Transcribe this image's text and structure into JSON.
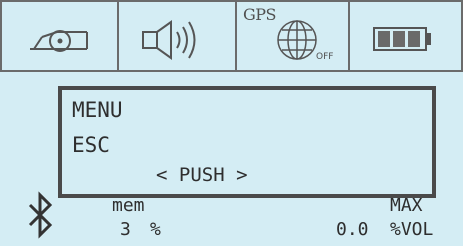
{
  "status_bar": {
    "icons": [
      "whistle-icon",
      "speaker-icon",
      "gps-globe-icon",
      "battery-icon"
    ],
    "gps_label": "GPS",
    "gps_state": "OFF"
  },
  "menu": {
    "items": [
      "MENU",
      "ESC"
    ],
    "action": "< PUSH >"
  },
  "footer": {
    "bluetooth_icon": "bluetooth-icon",
    "mem_label": "mem",
    "mem_value": "3",
    "mem_unit": "%",
    "max_label": "MAX",
    "vol_value": "0.0",
    "vol_unit": "%VOL"
  },
  "colors": {
    "background": "#d4edf4",
    "line": "#4a4a4a"
  }
}
